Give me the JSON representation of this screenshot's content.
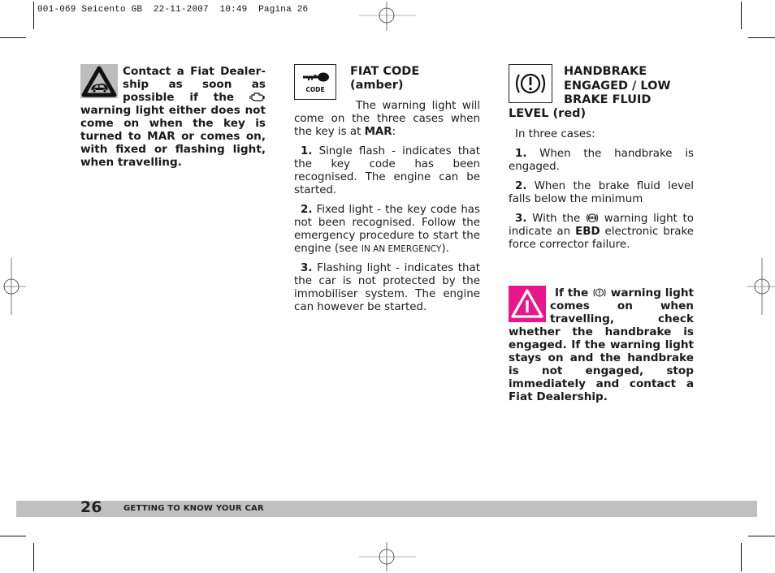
{
  "slug": {
    "file": "001-069 Seicento GB",
    "date": "22-11-2007",
    "time": "10:49",
    "page_label": "Pagina 26"
  },
  "column1": {
    "icon": "car-warning-triangle-icon",
    "text_1": "Contact a Fiat Dealer-ship as soon as possible if the ",
    "inline_icon": "engine-check-icon",
    "text_2": " warning light either does not come on when the key is turned to ",
    "mar": "MAR",
    "text_3": " or comes on, with fixed or flashing light, when travelling."
  },
  "column2": {
    "icon": "key-code-icon",
    "icon_label": "CODE",
    "title": "FIAT CODE",
    "subtitle": "(amber)",
    "intro_1": "The warning light will come on the three cases when the key is at ",
    "intro_mar": "MAR",
    "intro_2": ":",
    "items": [
      {
        "num": "1.",
        "text": " Single flash - indicates that the key code has been recognised. The engine can be started."
      },
      {
        "num": "2.",
        "text": " Fixed light - the key code has not been recognised. Follow the emergency procedure to start the engine (see ",
        "smallcaps": "IN AN EMERGENCY",
        "after": ")."
      },
      {
        "num": "3.",
        "text": " Flashing light - indicates that the car is not protected by the immobiliser system. The engine can however be started."
      }
    ]
  },
  "column3": {
    "icon": "handbrake-warning-icon",
    "title_lines": [
      "HANDBRAKE",
      "ENGAGED / LOW",
      "BRAKE FLUID"
    ],
    "title_last": "LEVEL (red)",
    "intro": "In three cases:",
    "items": [
      {
        "num": "1.",
        "text": " When the handbrake is engaged."
      },
      {
        "num": "2.",
        "text": " When the brake fluid level falls below the minimum"
      },
      {
        "num": "3.",
        "text_1": " With the ",
        "inline_icon": "abs-icon",
        "text_2": " warning light to indicate an ",
        "ebd": "EBD",
        "text_3": " electronic brake force corrector failure."
      }
    ],
    "warning": {
      "icon": "warning-triangle-icon",
      "text_1": "If the ",
      "inline_icon": "handbrake-icon",
      "text_2": " warning light comes on when travelling, check whether the handbrake is engaged. If the warning light stays on and the handbrake is not engaged, stop immediately and contact a Fiat Dealership."
    }
  },
  "footer": {
    "page_number": "26",
    "section_title": "GETTING TO KNOW YOUR CAR",
    "band_color": "#c0c0c0"
  },
  "colors": {
    "warning_pink": "#e8168a",
    "warning_grey": "#bdbdbd"
  }
}
